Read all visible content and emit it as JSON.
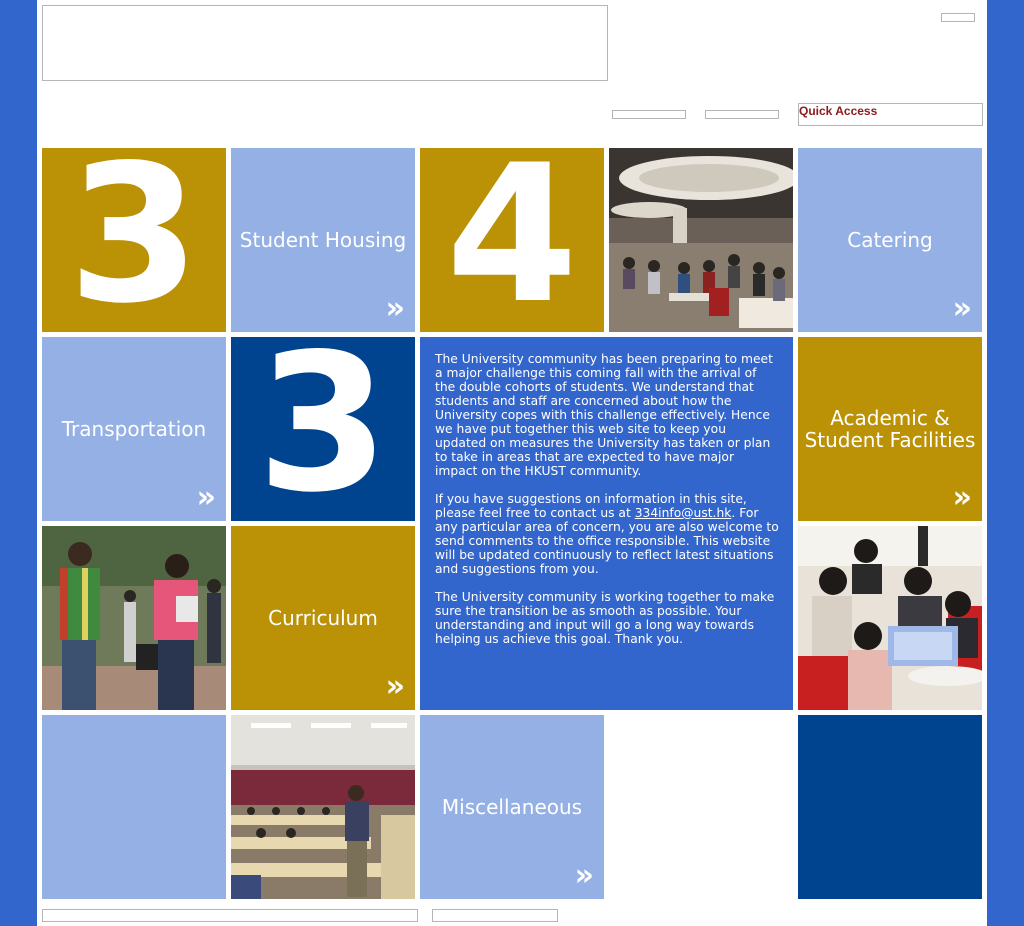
{
  "header": {
    "quick_access_label": "Quick Access"
  },
  "tiles": {
    "number_3a": "3",
    "student_housing": "Student Housing",
    "number_4": "4",
    "catering": "Catering",
    "transportation": "Transportation",
    "number_3b": "3",
    "academic_line1": "Academic &",
    "academic_line2": "Student Facilities",
    "curriculum": "Curriculum",
    "miscellaneous": "Miscellaneous",
    "chevron": "»"
  },
  "info": {
    "para1": "The University community has been preparing to meet a major challenge this coming fall with the arrival of the double cohorts of students. We understand that students and staff are concerned about how the University copes with this challenge effectively.  Hence we have put together this web site to keep you updated on measures the University has taken or plan to take in areas that are expected to have major impact on the HKUST community.",
    "para2_before": "If you have suggestions on information in this site, please feel free to contact us at ",
    "email": "334info@ust.hk",
    "para2_after": ". For any particular area of concern, you are also welcome to send comments to the office responsible. This website will be updated continuously to reflect latest situations and suggestions from you.",
    "para3": "The University community is working together to make sure the transition be as smooth as possible. Your understanding and input will go a long way towards helping us achieve this goal. Thank you."
  },
  "colors": {
    "gold": "#bb9105",
    "light_blue": "#94b0e4",
    "navy": "#00438f",
    "royal_blue": "#3366cc",
    "quick_access_text": "#8b1a1a"
  },
  "icons": [
    "chevron-double-right-icon"
  ]
}
